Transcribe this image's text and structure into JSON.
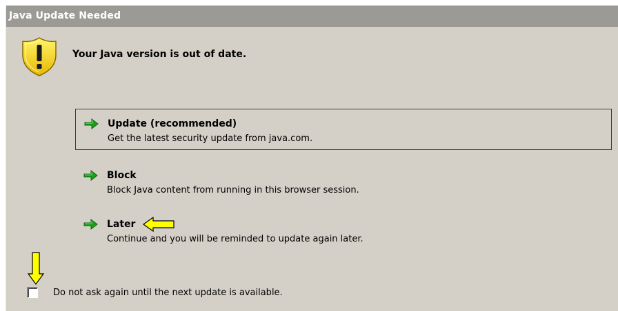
{
  "window": {
    "title": "Java Update Needed"
  },
  "header": {
    "message": "Your Java version is out of date.",
    "icon": "warning-shield-icon"
  },
  "options": [
    {
      "title": "Update (recommended)",
      "description": "Get the latest security update from java.com.",
      "selected": true,
      "icon": "green-arrow-icon"
    },
    {
      "title": "Block",
      "description": "Block Java content from running in this browser session.",
      "selected": false,
      "icon": "green-arrow-icon"
    },
    {
      "title": "Later",
      "description": "Continue and you will be reminded to update again later.",
      "selected": false,
      "icon": "green-arrow-icon"
    }
  ],
  "checkbox": {
    "label": "Do not ask again until the next update is available.",
    "checked": false
  },
  "colors": {
    "titlebar": "#9c9a94",
    "dialog_bg": "#d4d0c8",
    "arrow_green": "#1aa01a",
    "hint_yellow": "#ffff00"
  }
}
